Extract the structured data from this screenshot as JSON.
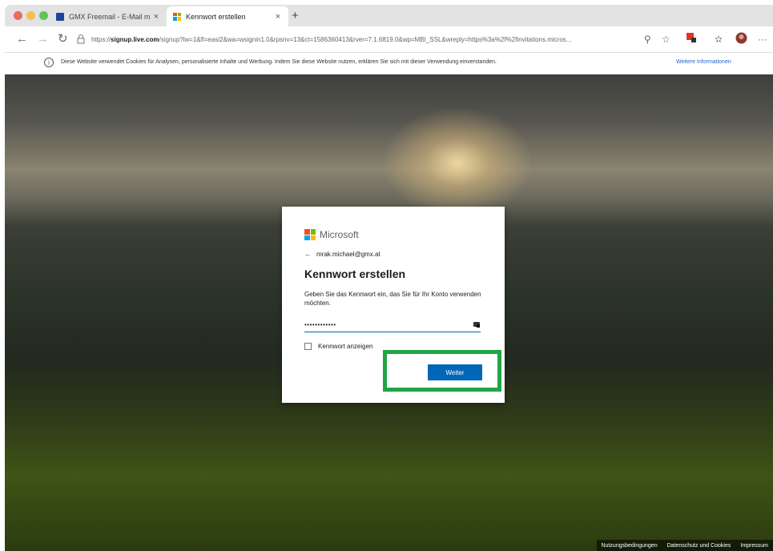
{
  "browser": {
    "tabs": [
      {
        "label": "GMX Freemail - E-Mail made in",
        "active": false
      },
      {
        "label": "Kennwort erstellen",
        "active": true
      }
    ],
    "close_glyph": "×",
    "new_tab_glyph": "+",
    "url_prefix": "https://",
    "url_host": "signup.live.com",
    "url_rest": "/signup?lw=1&fl=easi2&wa=wsignin1.0&rpsnv=13&ct=1586360413&rver=7.1.6819.0&wp=MBI_SSL&wreply=https%3a%2f%2finvitations.micros..."
  },
  "cookie_notice": {
    "text": "Diese Website verwendet Cookies für Analysen, personalisierte Inhalte und Werbung. Indem Sie diese Website nutzen, erklären Sie sich mit dieser Verwendung einverstanden.",
    "more_link": "Weitere Informationen"
  },
  "dialog": {
    "brand": "Microsoft",
    "email": "mrak.michael@gmx.at",
    "title": "Kennwort erstellen",
    "description": "Geben Sie das Kennwort ein, das Sie für Ihr Konto verwenden möchten.",
    "password_value": "••••••••••••",
    "show_password_label": "Kennwort anzeigen",
    "submit_label": "Weiter"
  },
  "footer": {
    "links": [
      "Nutzungsbedingungen",
      "Datenschutz und Cookies",
      "Impressum"
    ]
  },
  "colors": {
    "accent": "#0067b8",
    "highlight": "#21a446",
    "ms_red": "#f25022",
    "ms_green": "#7fba00",
    "ms_blue": "#00a4ef",
    "ms_yellow": "#ffb900"
  }
}
